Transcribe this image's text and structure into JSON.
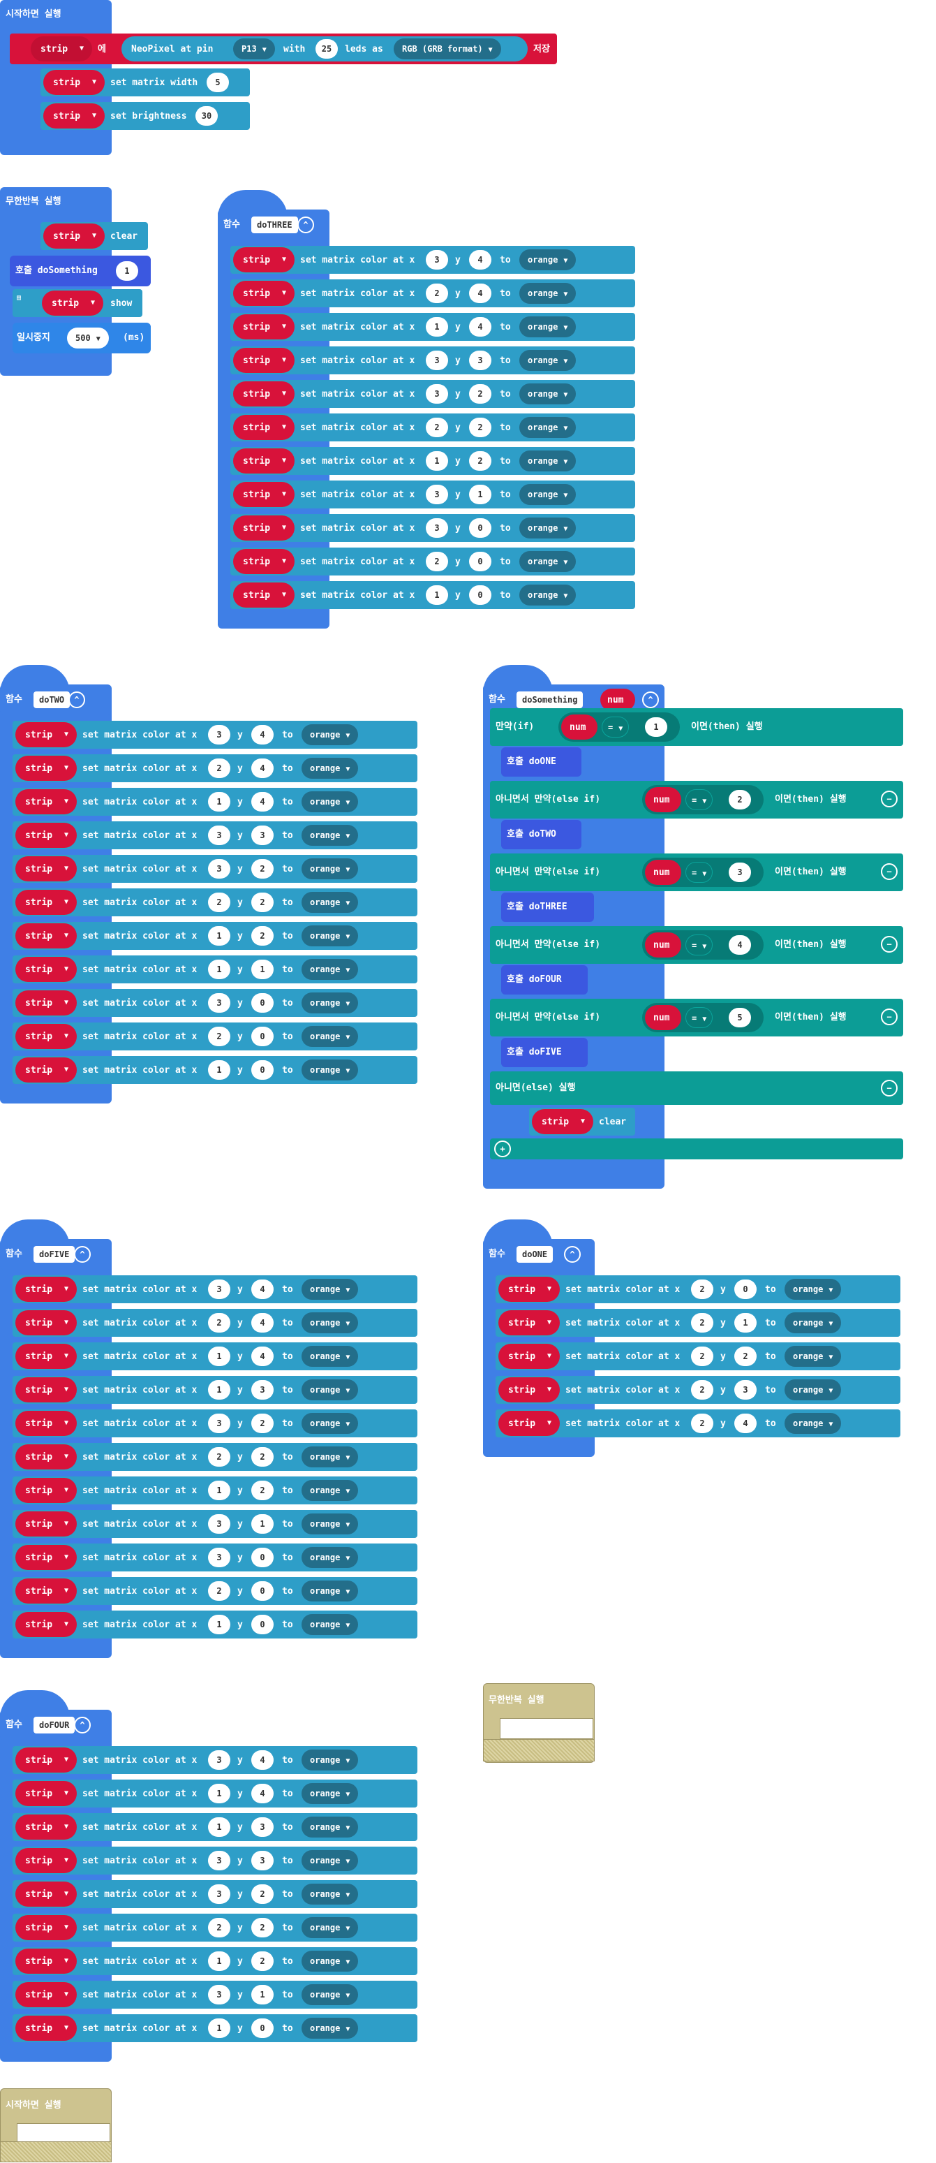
{
  "labels": {
    "on_start": "시작하면 실행",
    "forever": "무한반복 실행",
    "function": "함수",
    "call": "호출",
    "pause": "일시중지",
    "ms": "(ms)",
    "if_label": "만약(if)",
    "then_label": "이면(then) 실행",
    "else_if_label": "아니면서 만약(else if)",
    "else_label": "아니면(else) 실행",
    "set_color": "set matrix color at x",
    "y": "y",
    "to": "to",
    "strip": "strip",
    "clear": "clear",
    "show": "show",
    "set_width": "set matrix width",
    "set_brightness": "set brightness",
    "num": "num",
    "eq": "="
  },
  "on_start_block": {
    "init": {
      "var": "strip",
      "is": "에",
      "neopixel": "NeoPixel at pin",
      "pin": "P13",
      "with": "with",
      "leds": "25",
      "leds_as": "leds as",
      "format": "RGB (GRB format)",
      "save": "저장"
    },
    "width": "5",
    "brightness": "30"
  },
  "forever_block": {
    "func_name": "doSomething",
    "arg": "1",
    "pause": "500"
  },
  "functions": {
    "doTHREE": {
      "name": "doTHREE",
      "rows": [
        [
          3,
          4
        ],
        [
          2,
          4
        ],
        [
          1,
          4
        ],
        [
          3,
          3
        ],
        [
          3,
          2
        ],
        [
          2,
          2
        ],
        [
          1,
          2
        ],
        [
          3,
          1
        ],
        [
          3,
          0
        ],
        [
          2,
          0
        ],
        [
          1,
          0
        ]
      ]
    },
    "doTWO": {
      "name": "doTWO",
      "rows": [
        [
          3,
          4
        ],
        [
          2,
          4
        ],
        [
          1,
          4
        ],
        [
          3,
          3
        ],
        [
          3,
          2
        ],
        [
          2,
          2
        ],
        [
          1,
          2
        ],
        [
          1,
          1
        ],
        [
          3,
          0
        ],
        [
          2,
          0
        ],
        [
          1,
          0
        ]
      ]
    },
    "doFIVE": {
      "name": "doFIVE",
      "rows": [
        [
          3,
          4
        ],
        [
          2,
          4
        ],
        [
          1,
          4
        ],
        [
          1,
          3
        ],
        [
          3,
          2
        ],
        [
          2,
          2
        ],
        [
          1,
          2
        ],
        [
          3,
          1
        ],
        [
          3,
          0
        ],
        [
          2,
          0
        ],
        [
          1,
          0
        ]
      ]
    },
    "doONE": {
      "name": "doONE",
      "rows": [
        [
          2,
          0
        ],
        [
          2,
          1
        ],
        [
          2,
          2
        ],
        [
          2,
          3
        ],
        [
          2,
          4
        ]
      ]
    },
    "doFOUR": {
      "name": "doFOUR",
      "rows": [
        [
          3,
          4
        ],
        [
          1,
          4
        ],
        [
          1,
          3
        ],
        [
          3,
          3
        ],
        [
          3,
          2
        ],
        [
          2,
          2
        ],
        [
          1,
          2
        ],
        [
          3,
          1
        ],
        [
          1,
          0
        ]
      ]
    }
  },
  "color": "orange",
  "doSomething": {
    "name": "doSomething",
    "param": "num",
    "branches": [
      {
        "value": "1",
        "call": "doONE"
      },
      {
        "value": "2",
        "call": "doTWO"
      },
      {
        "value": "3",
        "call": "doTHREE"
      },
      {
        "value": "4",
        "call": "doFOUR"
      },
      {
        "value": "5",
        "call": "doFIVE"
      }
    ]
  }
}
